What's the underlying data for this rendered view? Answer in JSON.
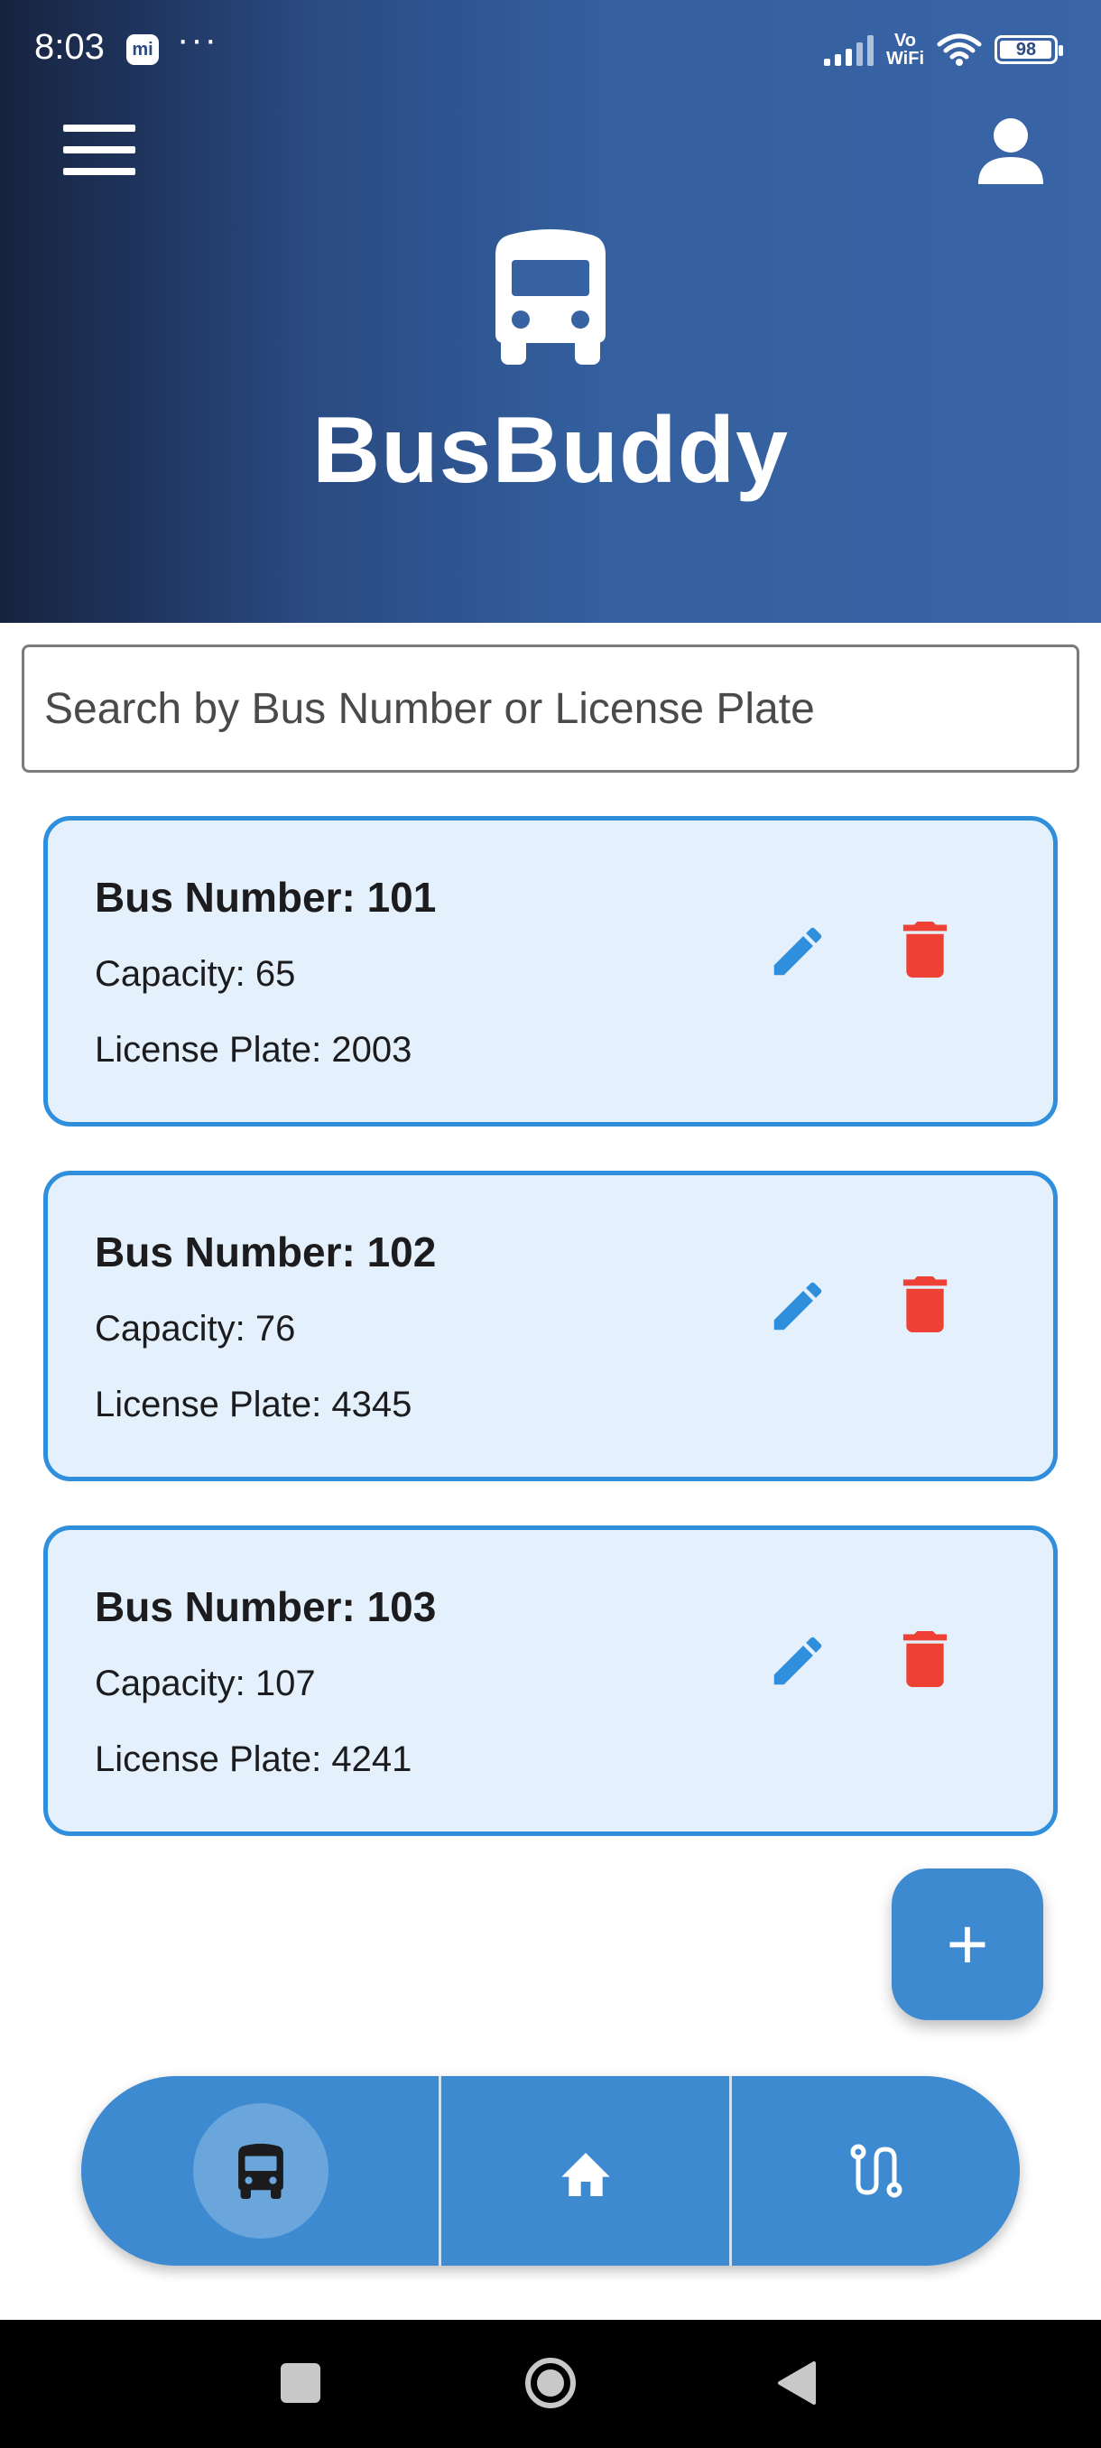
{
  "status_bar": {
    "time": "8:03",
    "mi_label": "mi",
    "dots": "···",
    "vowifi_top": "Vo",
    "vowifi_bottom": "WiFi",
    "battery": "98",
    "battery_level_percent": 98
  },
  "header": {
    "menu_icon": "hamburger-menu-icon",
    "profile_icon": "person-icon",
    "logo_icon": "bus-icon",
    "title": "BusBuddy",
    "gradient_colors": [
      "#16233f",
      "#3964a6"
    ]
  },
  "search": {
    "placeholder": "Search by Bus Number or License Plate",
    "value": ""
  },
  "buses": [
    {
      "title": "Bus Number: 101",
      "capacity": "Capacity: 65",
      "plate": "License Plate: 2003"
    },
    {
      "title": "Bus Number: 102",
      "capacity": "Capacity: 76",
      "plate": "License Plate: 4345"
    },
    {
      "title": "Bus Number: 103",
      "capacity": "Capacity: 107",
      "plate": "License Plate: 4241"
    }
  ],
  "card_actions": {
    "edit_icon": "pencil-icon",
    "delete_icon": "trash-icon"
  },
  "fab": {
    "label": "+",
    "icon": "plus-icon"
  },
  "bottom_nav": {
    "items": [
      {
        "icon": "bus-icon",
        "active": true
      },
      {
        "icon": "home-icon",
        "active": false
      },
      {
        "icon": "route-icon",
        "active": false
      }
    ]
  },
  "colors": {
    "accent": "#3e8ad0",
    "card_border": "#2f8fdc",
    "card_background": "#e4f1fc",
    "edit": "#2f8fdc",
    "delete": "#ee4035"
  },
  "system_nav": {
    "recents_icon": "square-icon",
    "home_icon": "circle-home-icon",
    "back_icon": "triangle-back-icon"
  }
}
